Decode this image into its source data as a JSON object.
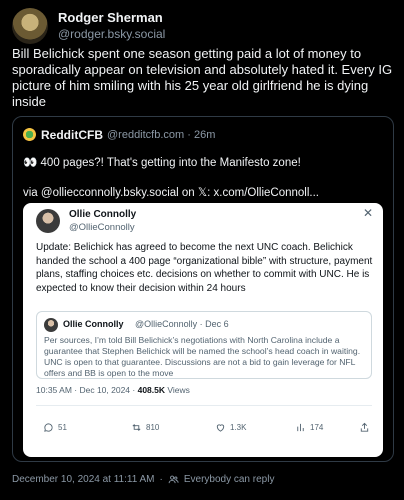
{
  "author": {
    "name": "Rodger Sherman",
    "handle": "@rodger.bsky.social"
  },
  "post_text": "Bill Belichick spent one season getting paid a lot of money to sporadically appear on television and absolutely hated it. Every IG picture of him smiling with his 25 year old girlfriend he is dying inside",
  "quote": {
    "name": "RedditCFB",
    "meta": "@redditcfb.com · 26m",
    "emoji": "👀",
    "text1": "400 pages?! That's getting into the Manifesto zone!",
    "text2": "via @olliecconnolly.bsky.social on 𝕏: x.com/OllieConnoll..."
  },
  "tweet": {
    "name": "Ollie Connolly",
    "handle": "@OllieConnolly",
    "close": "✕",
    "body": "Update: Belichick has agreed to become the next UNC coach. Belichick handed the school a 400 page “organizational bible” with structure, payment plans, staffing choices etc. decisions on whether to commit with UNC. He is expected to know their decision within 24 hours",
    "inner": {
      "name": "Ollie Connolly",
      "meta": "@OllieConnolly · Dec 6",
      "body": "Per sources, I’m told Bill Belichick’s negotiations with North Carolina include a guarantee that Stephen Belichick will be named the school’s head coach in waiting. UNC is open to that guarantee. Discussions are not a bid to gain leverage for NFL offers and BB is open to the move"
    },
    "date": "10:35 AM · Dec 10, 2024 · ",
    "views": "408.5K",
    "views_label": " Views",
    "stats": {
      "replies": "51",
      "reposts": "810",
      "likes": "1.3K",
      "bookmarks": "174"
    }
  },
  "footer": {
    "date": "December 10, 2024 at 11:11 AM",
    "separator": "·",
    "audience": "Everybody can reply"
  }
}
